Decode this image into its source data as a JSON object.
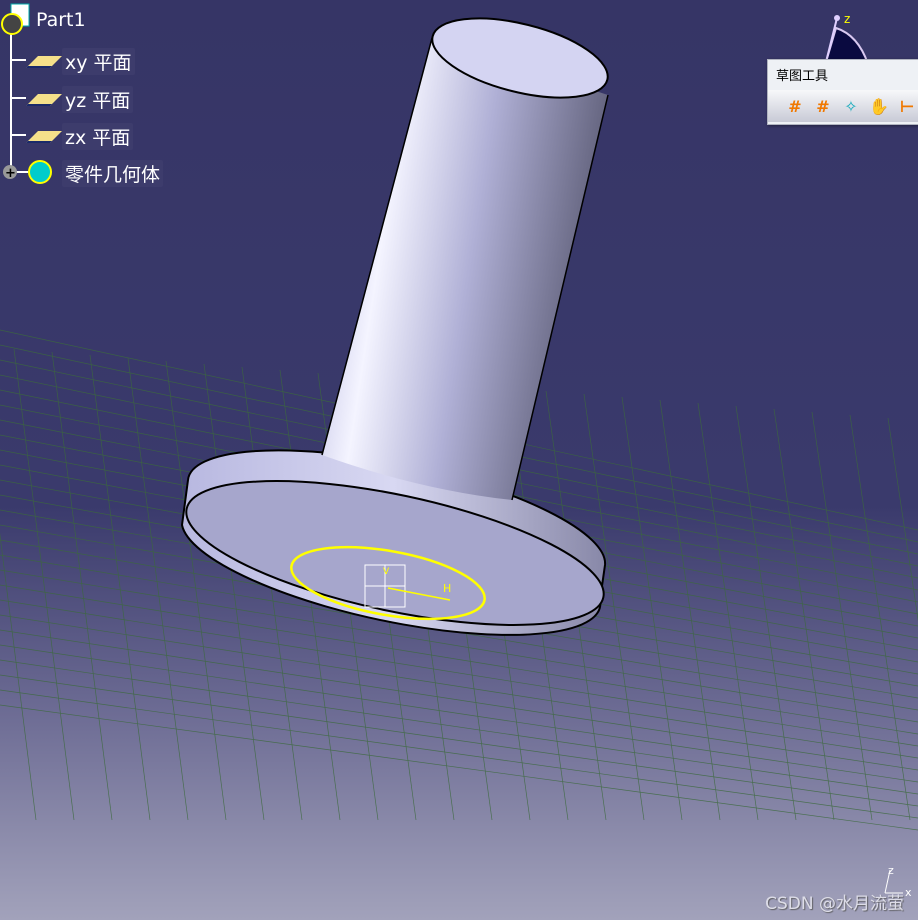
{
  "tree": {
    "root": "Part1",
    "items": [
      {
        "label": "xy 平面",
        "icon": "plane-icon"
      },
      {
        "label": "yz 平面",
        "icon": "plane-icon"
      },
      {
        "label": "zx 平面",
        "icon": "plane-icon"
      },
      {
        "label": "零件几何体",
        "icon": "body-icon",
        "expand": "+"
      }
    ]
  },
  "toolbar": {
    "title": "草图工具",
    "buttons": [
      "grid-icon",
      "snap-to-point-icon",
      "construction-element-icon",
      "geometrical-constraints-icon",
      "dimensional-constraints-icon"
    ]
  },
  "compass": {
    "axis": "z"
  },
  "sketch_axis": {
    "h": "H",
    "v": "V"
  },
  "corner_axes": {
    "z": "z",
    "x": "x"
  },
  "watermark": "CSDN @水月流萤",
  "colors": {
    "background_top": "#363566",
    "background_bottom": "#a2a2bb",
    "part": "#c8c8ea",
    "sketch": "#ffff00",
    "grid": "#3c6a3c"
  }
}
